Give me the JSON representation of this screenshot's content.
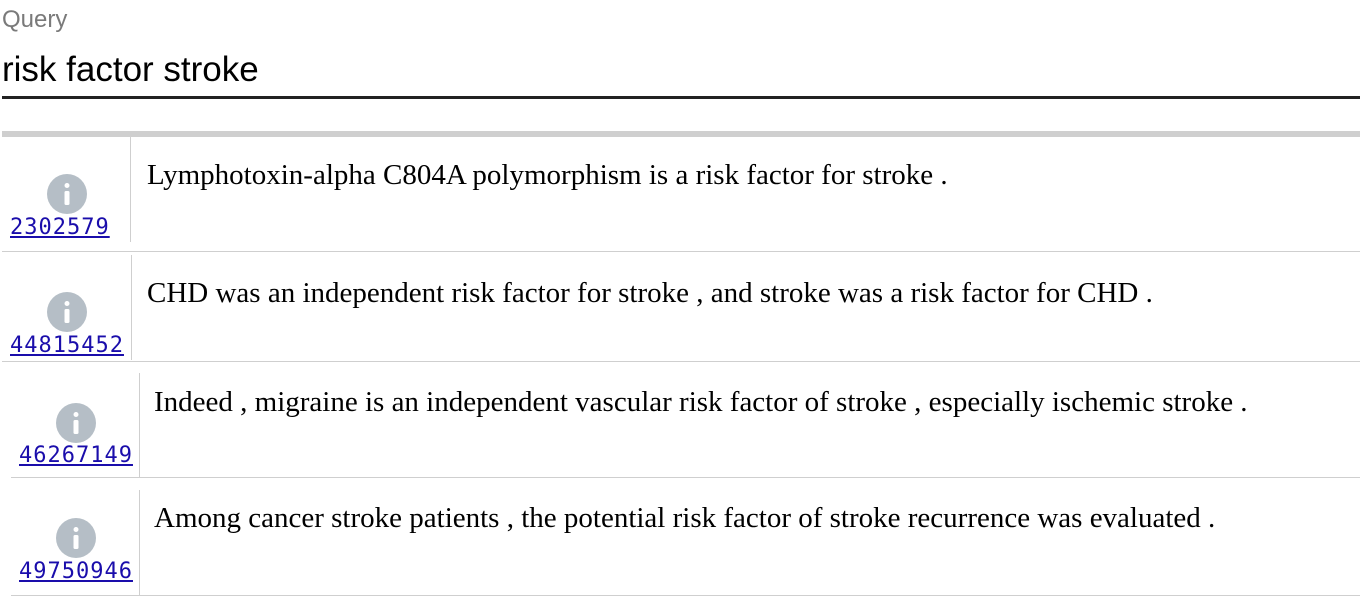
{
  "query": {
    "label": "Query",
    "value": "risk factor stroke"
  },
  "results": [
    {
      "id": "2302579",
      "text": "Lymphotoxin-alpha C804A polymorphism is a risk factor for stroke ."
    },
    {
      "id": "44815452",
      "text": "CHD was an independent risk factor for stroke , and stroke was a risk factor for CHD ."
    },
    {
      "id": "46267149",
      "text": "Indeed , migraine is an independent vascular risk factor of stroke , especially ischemic stroke ."
    },
    {
      "id": "49750946",
      "text": "Among cancer stroke patients , the potential risk factor of stroke recurrence was evaluated ."
    }
  ],
  "icons": {
    "info": "info-icon"
  },
  "colors": {
    "link": "#1a0dab",
    "icon": "#b5bec6",
    "divider": "#cfcfcf",
    "underline": "#222222"
  }
}
